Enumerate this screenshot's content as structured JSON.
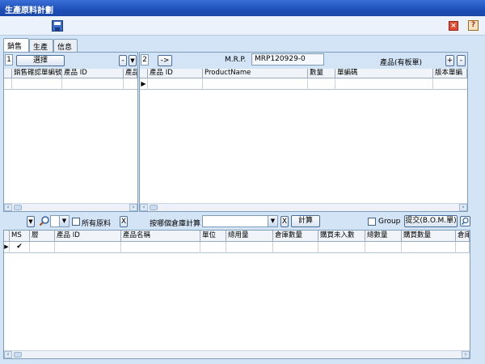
{
  "window": {
    "title": "生產原料計劃"
  },
  "toolbar": {
    "save_icon": "save-icon",
    "close_icon": "close-icon",
    "close_glyph": "×",
    "help_icon": "help-icon",
    "help_glyph": "?"
  },
  "tabs": [
    {
      "label": "銷售",
      "active": true
    },
    {
      "label": "生產",
      "active": false
    },
    {
      "label": "信息",
      "active": false
    }
  ],
  "left_panel": {
    "number": "1",
    "select_button": "選擇",
    "minus_button": "-",
    "filter_button": "▼",
    "columns": [
      "銷售確認單編號",
      "產品 ID",
      "產品"
    ]
  },
  "right_panel": {
    "number": "2",
    "arrow_button": "->",
    "mrp_label": "M.R.P.",
    "mrp_value": "MRP120929-0",
    "product_label": "產品(有板單)",
    "plus_button": "+",
    "minus_button": "-",
    "columns": [
      "產品 ID",
      "ProductName",
      "數量",
      "單編碼",
      "版本單編"
    ]
  },
  "mid_bar": {
    "filter_button": "▼",
    "search_icon": "magnifier-icon",
    "level_value": "",
    "all_materials_label": "所有原料",
    "clear_button_1": "X",
    "warehouse_label": "按哪個倉庫計算",
    "warehouse_value": "",
    "clear_button_2": "X",
    "calc_button": "計算",
    "group_label": "Group",
    "submit_button": "提交(B.O.M.單)",
    "zoom_icon": "zoom-icon"
  },
  "bottom_table": {
    "columns": [
      "MS",
      "層",
      "產品 ID",
      "產品名稱",
      "單位",
      "總用量",
      "倉庫數量",
      "購買未入數",
      "總數量",
      "購買數量",
      "倉庫"
    ],
    "rows": [
      {
        "ms": "✔",
        "layer": "",
        "id": "",
        "name": "",
        "unit": "",
        "usage": "",
        "stock": "",
        "pending": "",
        "total": "",
        "buy": "",
        "wh": ""
      }
    ]
  },
  "scroll": {
    "left": "‹",
    "right": "›"
  }
}
